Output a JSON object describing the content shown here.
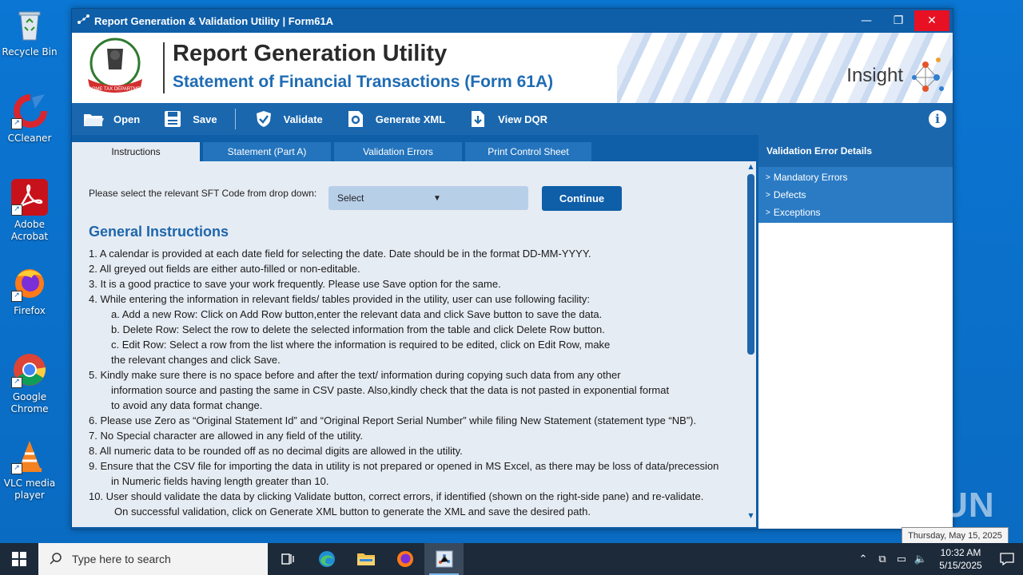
{
  "desktop": {
    "icons": [
      {
        "label": "Recycle Bin"
      },
      {
        "label": "CCleaner"
      },
      {
        "label": "Adobe Acrobat"
      },
      {
        "label": "Firefox"
      },
      {
        "label": "Google Chrome"
      },
      {
        "label": "VLC media player"
      }
    ]
  },
  "window": {
    "title": "Report Generation & Validation Utility | Form61A",
    "controls": {
      "minimize": "—",
      "maximize": "❐",
      "close": "✕"
    }
  },
  "banner": {
    "title": "Report Generation Utility",
    "subtitle": "Statement of Financial Transactions (Form 61A)",
    "emblem_text": "INCOME TAX DEPARTMENT",
    "brand": "Insight"
  },
  "toolbar": {
    "open": "Open",
    "save": "Save",
    "validate": "Validate",
    "generate_xml": "Generate XML",
    "view_dqr": "View DQR",
    "info": "i"
  },
  "tabs": [
    {
      "label": "Instructions",
      "active": true
    },
    {
      "label": "Statement (Part A)",
      "active": false
    },
    {
      "label": "Validation Errors",
      "active": false
    },
    {
      "label": "Print Control Sheet",
      "active": false
    }
  ],
  "main": {
    "sft_prompt": "Please select the relevant SFT Code from drop down:",
    "sft_select_value": "Select",
    "continue_label": "Continue",
    "instructions_title": "General Instructions",
    "instructions": [
      "1. A calendar is provided at each date field for selecting the date. Date should be in the format DD-MM-YYYY.",
      "2. All greyed out fields are either auto-filled or non-editable.",
      "3. It is a good practice to save your work frequently. Please use Save option for the same.",
      "4. While entering the information in relevant fields/ tables provided in the utility, user can use following facility:",
      "a. Add a new Row: Click on Add Row button,enter the relevant data and click Save button to save the data.",
      "b. Delete Row: Select the row to delete the selected information from the table and click Delete Row button.",
      "c. Edit Row: Select a row from the list where the information is required to be edited, click on Edit Row, make",
      "the relevant changes and click Save.",
      " 5. Kindly make sure there is no space before and after the text/ information during copying such data from any other",
      "information source and pasting the same in CSV paste. Also,kindly check that the data is not pasted in exponential format",
      "to avoid any data format change.",
      "6. Please use Zero as “Original Statement Id” and “Original Report Serial Number” while filing New Statement (statement type “NB”).",
      "7. No Special character are allowed in any field of the utility.",
      "8. All numeric data to be rounded off as no decimal digits are allowed in the utility.",
      "9. Ensure that the CSV file for importing the data in utility is not prepared or opened in MS Excel, as there may be loss of data/precession",
      "in Numeric fields having length greater than 10.",
      "10. User should validate the data by clicking Validate button, correct errors, if identified (shown on the right-side pane) and re-validate.",
      "On successful validation, click on Generate XML button to generate the XML and save the desired path."
    ]
  },
  "side_panel": {
    "header": "Validation Error Details",
    "items": [
      "Mandatory Errors",
      "Defects",
      "Exceptions"
    ]
  },
  "watermark": "ANY RUN",
  "tooltip": "Thursday, May 15, 2025",
  "taskbar": {
    "search_placeholder": "Type here to search",
    "time": "10:32 AM",
    "date": "5/15/2025"
  }
}
